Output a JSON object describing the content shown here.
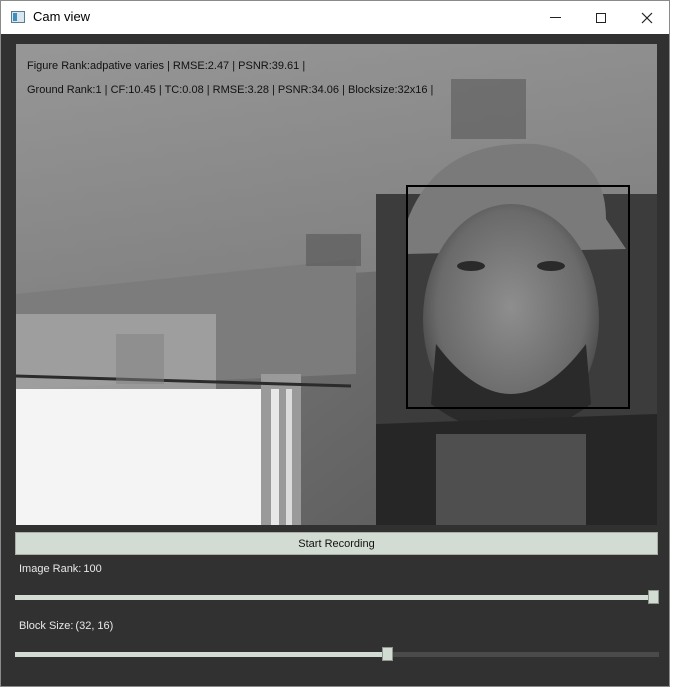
{
  "window": {
    "title": "Cam view",
    "icon": "app-window-icon"
  },
  "video": {
    "overlay_line1": "Figure Rank:adpative varies | RMSE:2.47 | PSNR:39.61 |",
    "overlay_line2": "Ground Rank:1 | CF:10.45 | TC:0.08 | RMSE:3.28 | PSNR:34.06 | Blocksize:32x16 |",
    "face_box_color": "#000000"
  },
  "controls": {
    "record_button": "Start Recording",
    "image_rank": {
      "label": "Image Rank:",
      "value": "100",
      "fraction": 1.0
    },
    "block_size": {
      "label": "Block Size:",
      "value": "(32, 16)",
      "fraction": 0.58
    }
  },
  "colors": {
    "window_bg": "#313131",
    "accent": "#d3dcd2"
  }
}
